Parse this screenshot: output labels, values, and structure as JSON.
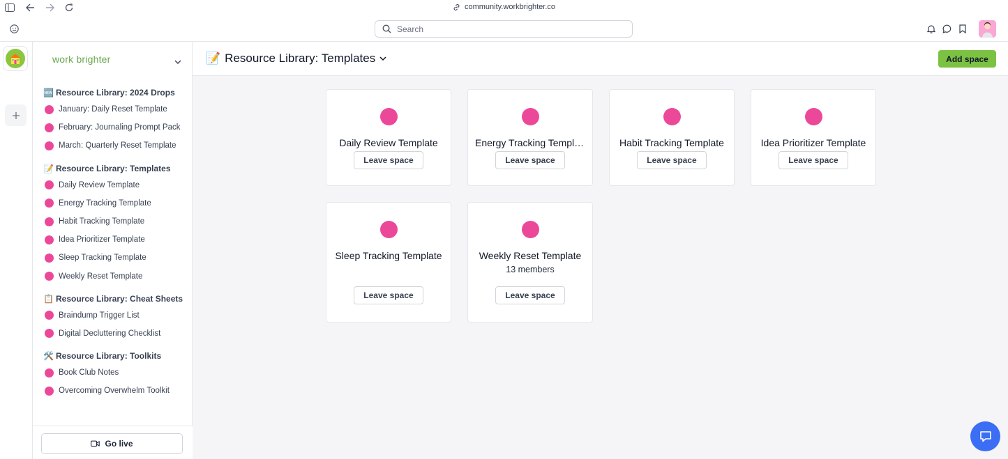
{
  "browser": {
    "url": "community.workbrighter.co",
    "search_placeholder": "Search"
  },
  "sidebar": {
    "brand": "work brighter",
    "groups": [
      {
        "emoji": "🆕",
        "title": "Resource Library: 2024 Drops",
        "items": [
          "January: Daily Reset Template",
          "February: Journaling Prompt Pack",
          "March: Quarterly Reset Template"
        ]
      },
      {
        "emoji": "📝",
        "title": "Resource Library: Templates",
        "items": [
          "Daily Review Template",
          "Energy Tracking Template",
          "Habit Tracking Template",
          "Idea Prioritizer Template",
          "Sleep Tracking Template",
          "Weekly Reset Template"
        ]
      },
      {
        "emoji": "📋",
        "title": "Resource Library: Cheat Sheets",
        "items": [
          "Braindump Trigger List",
          "Digital Decluttering Checklist"
        ]
      },
      {
        "emoji": "🛠️",
        "title": "Resource Library: Toolkits",
        "items": [
          "Book Club Notes",
          "Overcoming Overwhelm Toolkit"
        ]
      }
    ],
    "go_live_label": "Go live"
  },
  "main": {
    "title_emoji": "📝",
    "title": "Resource Library: Templates",
    "add_space_label": "Add space",
    "leave_label": "Leave space",
    "cards": [
      {
        "name": "Daily Review Template",
        "members": ""
      },
      {
        "name": "Energy Tracking Template",
        "members": ""
      },
      {
        "name": "Habit Tracking Template",
        "members": ""
      },
      {
        "name": "Idea Prioritizer Template",
        "members": ""
      },
      {
        "name": "Sleep Tracking Template",
        "members": ""
      },
      {
        "name": "Weekly Reset Template",
        "members": "13 members"
      }
    ]
  },
  "colors": {
    "accent_green": "#7cc242",
    "space_dot": "#ec4899",
    "chat_blue": "#3b6ef5"
  }
}
